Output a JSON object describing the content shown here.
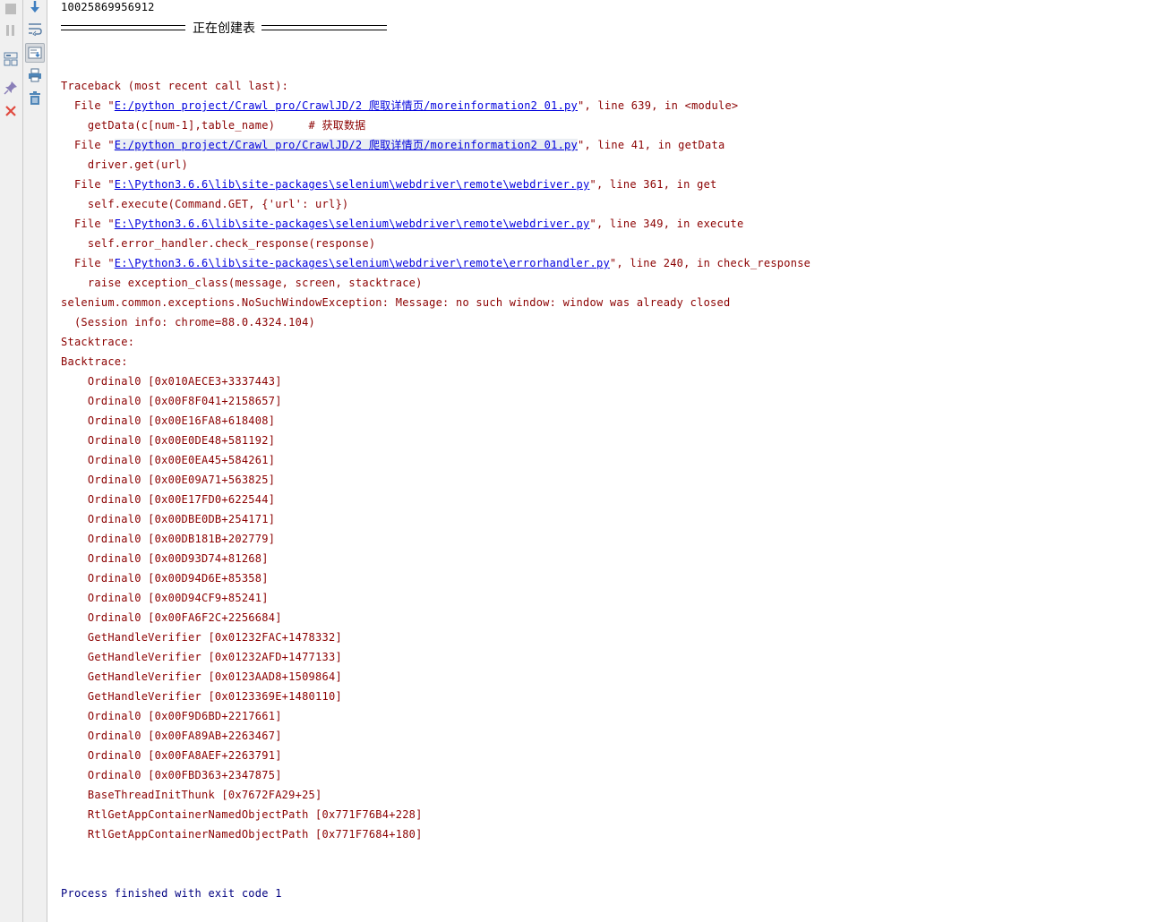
{
  "toolbar": {
    "left": [
      {
        "name": "stop-icon",
        "title": "Stop"
      },
      {
        "name": "pause-icon",
        "title": "Pause"
      },
      {
        "name": "restore-layout-icon",
        "title": "Restore Layout"
      },
      {
        "name": "pin-tab-icon",
        "title": "Pin Tab"
      },
      {
        "name": "close-icon",
        "title": "Close"
      }
    ],
    "right": [
      {
        "name": "scroll-down-icon",
        "title": "Down to the end"
      },
      {
        "name": "soft-wrap-icon",
        "title": "Soft-Wrap"
      },
      {
        "name": "scroll-to-end-icon",
        "title": "Scroll to the end"
      },
      {
        "name": "print-icon",
        "title": "Print"
      },
      {
        "name": "clear-all-icon",
        "title": "Clear All"
      }
    ]
  },
  "console": {
    "id_line": "10025869956912",
    "separator_title": "正在创建表",
    "traceback_header": "Traceback (most recent call last):",
    "frames": [
      {
        "file_prefix": "  File \"",
        "path": "E:/python project/Crawl pro/CrawlJD/2 爬取详情页/moreinformation2 01.py",
        "suffix": "\", line 639, in <module>",
        "code": "    getData(c[num-1],table_name)     # 获取数据"
      },
      {
        "file_prefix": "  File \"",
        "path": "E:/python project/Crawl pro/CrawlJD/2 爬取详情页/moreinformation2 01.py",
        "suffix": "\", line 41, in getData",
        "code": "    driver.get(url)"
      },
      {
        "file_prefix": "  File \"",
        "path": "E:\\Python3.6.6\\lib\\site-packages\\selenium\\webdriver\\remote\\webdriver.py",
        "suffix": "\", line 361, in get",
        "code": "    self.execute(Command.GET, {'url': url})"
      },
      {
        "file_prefix": "  File \"",
        "path": "E:\\Python3.6.6\\lib\\site-packages\\selenium\\webdriver\\remote\\webdriver.py",
        "suffix": "\", line 349, in execute",
        "code": "    self.error_handler.check_response(response)"
      },
      {
        "file_prefix": "  File \"",
        "path": "E:\\Python3.6.6\\lib\\site-packages\\selenium\\webdriver\\remote\\errorhandler.py",
        "suffix": "\", line 240, in check_response",
        "code": "    raise exception_class(message, screen, stacktrace)"
      }
    ],
    "exception": "selenium.common.exceptions.NoSuchWindowException: Message: no such window: window was already closed",
    "session_info": "  (Session info: chrome=88.0.4324.104)",
    "stacktrace_label": "Stacktrace:",
    "backtrace_label": "Backtrace:",
    "backtrace": [
      "    Ordinal0 [0x010AECE3+3337443]",
      "    Ordinal0 [0x00F8F041+2158657]",
      "    Ordinal0 [0x00E16FA8+618408]",
      "    Ordinal0 [0x00E0DE48+581192]",
      "    Ordinal0 [0x00E0EA45+584261]",
      "    Ordinal0 [0x00E09A71+563825]",
      "    Ordinal0 [0x00E17FD0+622544]",
      "    Ordinal0 [0x00DBE0DB+254171]",
      "    Ordinal0 [0x00DB181B+202779]",
      "    Ordinal0 [0x00D93D74+81268]",
      "    Ordinal0 [0x00D94D6E+85358]",
      "    Ordinal0 [0x00D94CF9+85241]",
      "    Ordinal0 [0x00FA6F2C+2256684]",
      "    GetHandleVerifier [0x01232FAC+1478332]",
      "    GetHandleVerifier [0x01232AFD+1477133]",
      "    GetHandleVerifier [0x0123AAD8+1509864]",
      "    GetHandleVerifier [0x0123369E+1480110]",
      "    Ordinal0 [0x00F9D6BD+2217661]",
      "    Ordinal0 [0x00FA89AB+2263467]",
      "    Ordinal0 [0x00FA8AEF+2263791]",
      "    Ordinal0 [0x00FBD363+2347875]",
      "    BaseThreadInitThunk [0x7672FA29+25]",
      "    RtlGetAppContainerNamedObjectPath [0x771F76B4+228]",
      "    RtlGetAppContainerNamedObjectPath [0x771F7684+180]"
    ],
    "exit_message": "Process finished with exit code 1"
  }
}
